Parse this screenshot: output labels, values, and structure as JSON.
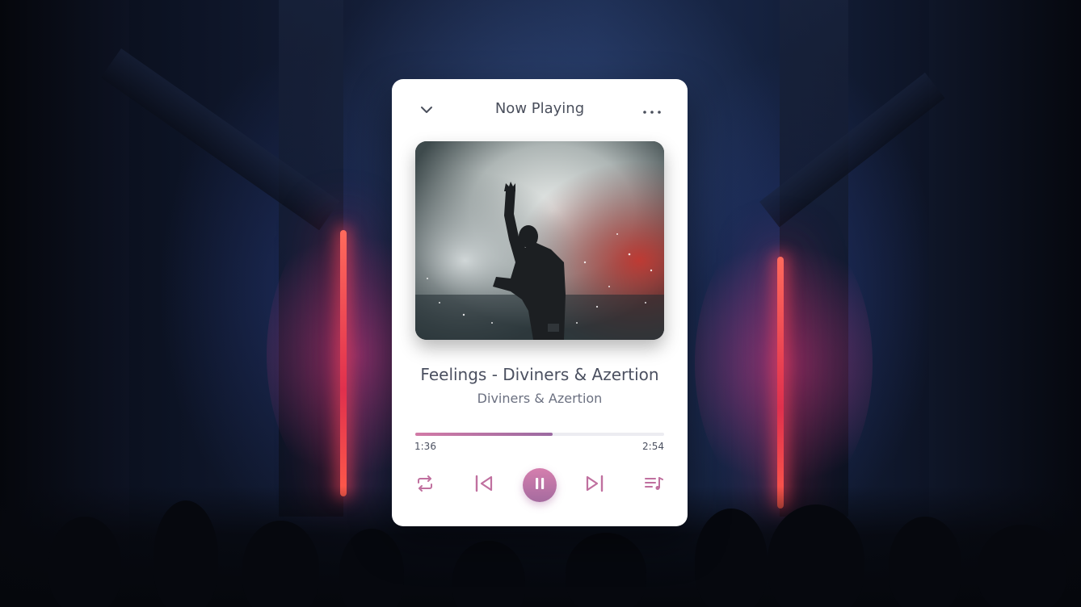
{
  "player": {
    "header_title": "Now Playing",
    "song_title": "Feelings - Diviners & Azertion",
    "artist": "Diviners & Azertion",
    "time_elapsed": "1:36",
    "time_total": "2:54",
    "progress_fraction": 0.552,
    "is_playing": true
  },
  "icons": {
    "collapse": "chevron-down-icon",
    "more": "more-horizontal-icon",
    "repeat": "repeat-icon",
    "previous": "skip-previous-icon",
    "play_pause": "pause-icon",
    "next": "skip-next-icon",
    "queue": "playlist-icon"
  },
  "colors": {
    "accent_start": "#d27aa6",
    "accent_end": "#9b6aa1",
    "icon_pink": "#c0709f",
    "text_dark": "#4a4f5c"
  }
}
